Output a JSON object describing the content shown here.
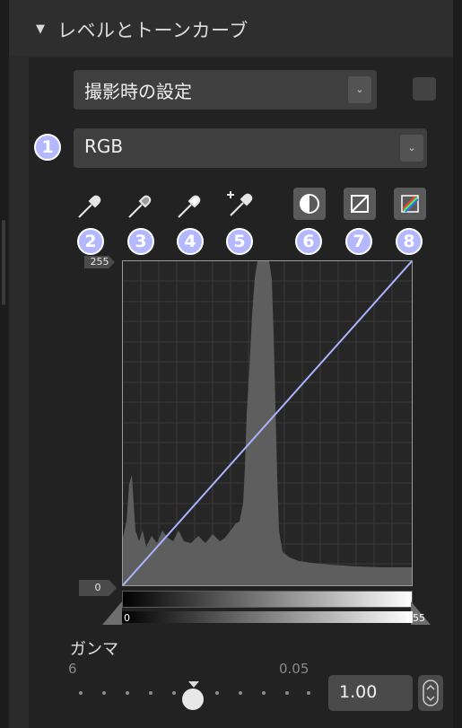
{
  "section": {
    "title": "レベルとトーンカーブ",
    "collapse_glyph": "▼"
  },
  "preset_dropdown": {
    "value": "撮影時の設定",
    "arrow": "⌄"
  },
  "channel_dropdown": {
    "value": "RGB",
    "arrow": "⌄"
  },
  "badges": [
    "1",
    "2",
    "3",
    "4",
    "5",
    "6",
    "7",
    "8"
  ],
  "tools": [
    {
      "icon": "eyedropper-icon"
    },
    {
      "icon": "eyedropper-icon"
    },
    {
      "icon": "eyedropper-icon"
    },
    {
      "icon": "eyedropper-plus-icon"
    }
  ],
  "tone_buttons": [
    {
      "icon": "contrast-icon"
    },
    {
      "icon": "reset-curve-icon"
    },
    {
      "icon": "color-channel-icon"
    }
  ],
  "graph": {
    "output_top_label": "255",
    "output_bottom_label": "0",
    "input_low_label": "0",
    "input_high_label": "255",
    "curve_color": "#a9b3ff"
  },
  "gamma": {
    "label": "ガンマ",
    "min_label": "6",
    "max_label": "0.05",
    "value": "1.00"
  },
  "colors": {
    "badge": "#b3b8ff",
    "panel": "#222222",
    "header": "#2e2e2e"
  }
}
